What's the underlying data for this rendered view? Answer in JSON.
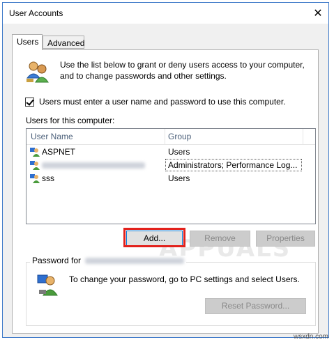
{
  "window": {
    "title": "User Accounts",
    "close_glyph": "✕"
  },
  "tabs": [
    {
      "label": "Users",
      "active": true
    },
    {
      "label": "Advanced",
      "active": false
    }
  ],
  "intro": {
    "line1": "Use the list below to grant or deny users access to your computer,",
    "line2": "and to change passwords and other settings.",
    "icon": "users-icon"
  },
  "checkbox": {
    "label": "Users must enter a user name and password to use this computer.",
    "checked": true
  },
  "users_section": {
    "label": "Users for this computer:"
  },
  "table": {
    "columns": [
      "User Name",
      "Group"
    ],
    "rows": [
      {
        "name": "ASPNET",
        "group": "Users",
        "icon": "user-icon"
      },
      {
        "name": "",
        "group": "Administrators; Performance Log...",
        "icon": "user-icon",
        "name_redacted": true
      },
      {
        "name": "sss",
        "group": "Users",
        "icon": "user-icon"
      }
    ]
  },
  "buttons": {
    "add": "Add...",
    "remove": "Remove",
    "properties": "Properties",
    "reset_password": "Reset Password..."
  },
  "password_group": {
    "label": "Password for",
    "text": "To change your password, go to PC settings and select Users.",
    "icon": "user-password-icon"
  },
  "watermark": {
    "text": "APPUALS"
  },
  "corner_credit": "wsxdn.com",
  "colors": {
    "highlight": "#e2211c",
    "accent": "#0078d7"
  }
}
